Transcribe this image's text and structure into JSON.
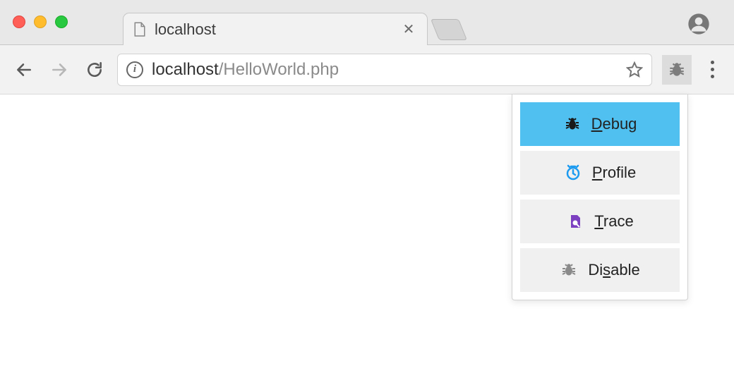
{
  "window": {
    "tab_title": "localhost"
  },
  "toolbar": {
    "url_host": "localhost",
    "url_path": "/HelloWorld.php"
  },
  "dropdown": {
    "items": [
      {
        "id": "debug",
        "label_pre": "",
        "label_u": "D",
        "label_post": "ebug",
        "active": true
      },
      {
        "id": "profile",
        "label_pre": "",
        "label_u": "P",
        "label_post": "rofile",
        "active": false
      },
      {
        "id": "trace",
        "label_pre": "",
        "label_u": "T",
        "label_post": "race",
        "active": false
      },
      {
        "id": "disable",
        "label_pre": "Di",
        "label_u": "s",
        "label_post": "able",
        "active": false
      }
    ]
  }
}
